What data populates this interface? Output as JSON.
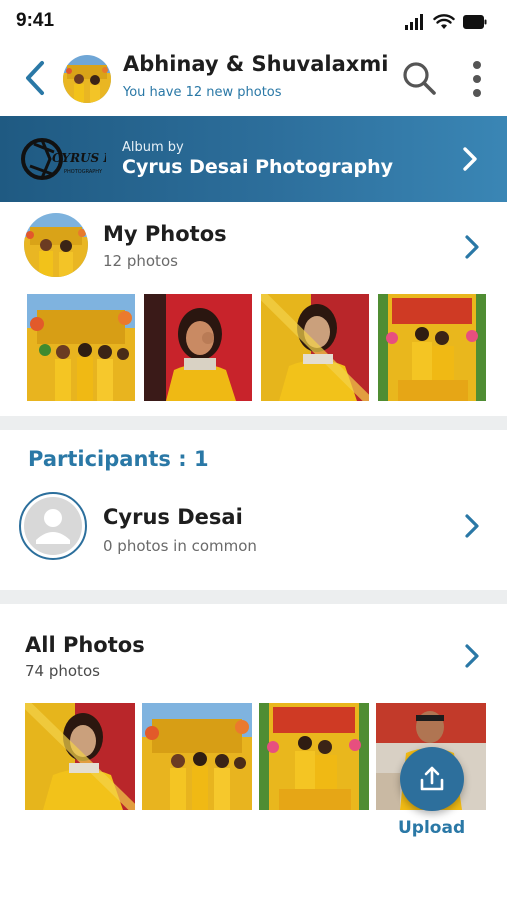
{
  "status_bar": {
    "time": "9:41"
  },
  "header": {
    "title": "Abhinay & Shuvalaxmi",
    "subtitle": "You have 12 new photos"
  },
  "album": {
    "by_label": "Album by",
    "name": "Cyrus Desai Photography",
    "logo_text": "CYRUS DESAI",
    "logo_subtext": "PHOTOGRAPHY"
  },
  "my_photos": {
    "title": "My Photos",
    "count": "12 photos"
  },
  "participants": {
    "title": "Participants : 1",
    "items": [
      {
        "name": "Cyrus Desai",
        "common": "0 photos in common"
      }
    ]
  },
  "all_photos": {
    "title": "All Photos",
    "count": "74 photos",
    "upload_label": "Upload"
  },
  "colors": {
    "accent": "#2a78a6",
    "banner_dark": "#1f5a82",
    "banner_light": "#3a86b5",
    "divider": "#eceeef",
    "photo_yellow": "#e7b51c"
  },
  "icons": [
    "back-chevron-icon",
    "search-icon",
    "more-vertical-icon",
    "chevron-right-icon",
    "user-placeholder-icon",
    "upload-icon",
    "signal-icon",
    "wifi-icon",
    "battery-icon"
  ]
}
